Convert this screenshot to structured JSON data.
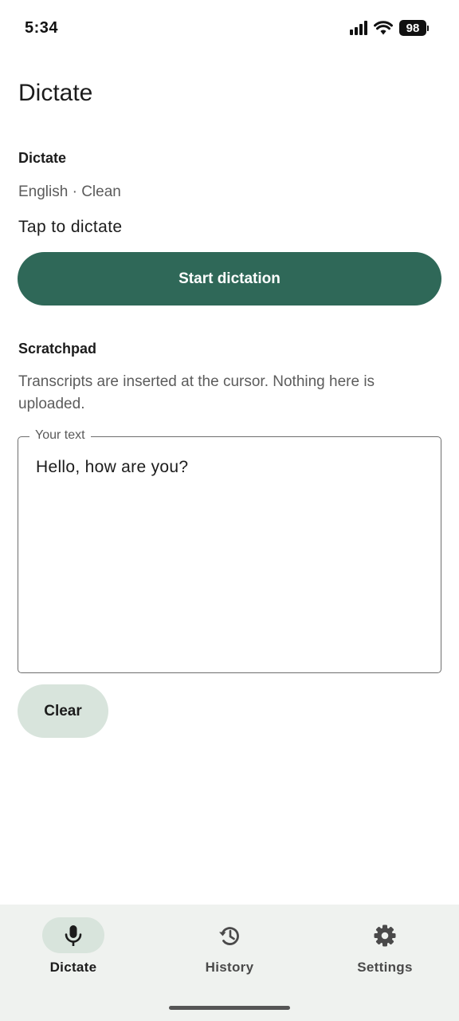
{
  "status_bar": {
    "time": "5:34",
    "battery_level": "98",
    "icons": [
      "cellular-signal-icon",
      "wifi-icon",
      "battery-icon"
    ]
  },
  "page": {
    "title": "Dictate"
  },
  "dictate_section": {
    "title": "Dictate",
    "language_mode": "English · Clean",
    "prompt": "Tap to dictate",
    "start_button_label": "Start dictation"
  },
  "scratchpad": {
    "title": "Scratchpad",
    "description": "Transcripts are inserted at the cursor. Nothing here is uploaded.",
    "field_label": "Your text",
    "field_value": "Hello, how are you?",
    "clear_button_label": "Clear"
  },
  "bottom_nav": {
    "items": [
      {
        "label": "Dictate",
        "icon": "microphone-icon",
        "active": true
      },
      {
        "label": "History",
        "icon": "history-icon",
        "active": false
      },
      {
        "label": "Settings",
        "icon": "gear-icon",
        "active": false
      }
    ]
  },
  "colors": {
    "primary": "#2f6858",
    "secondary_container": "#d8e4dc",
    "nav_background": "#eff2ef",
    "text_primary": "#1c1c1c",
    "text_secondary": "#5c5c5c"
  }
}
